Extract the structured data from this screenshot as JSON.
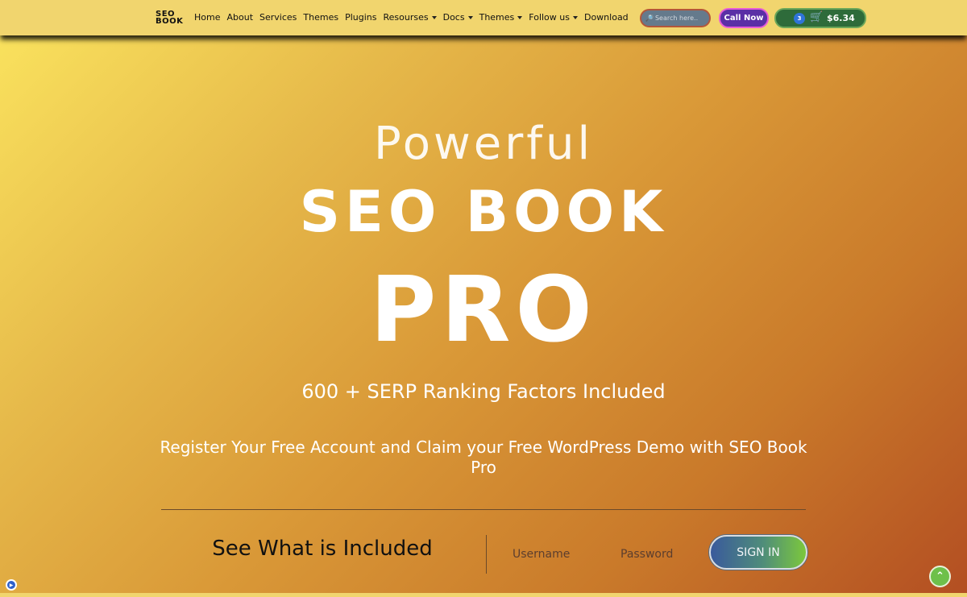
{
  "nav": {
    "logo_line1": "SEO",
    "logo_line2": "BOOK",
    "links": [
      {
        "label": "Home",
        "dropdown": false
      },
      {
        "label": "About",
        "dropdown": false
      },
      {
        "label": "Services",
        "dropdown": false
      },
      {
        "label": "Themes",
        "dropdown": false
      },
      {
        "label": "Plugins",
        "dropdown": false
      },
      {
        "label": "Resourses",
        "dropdown": true
      },
      {
        "label": "Docs",
        "dropdown": true
      },
      {
        "label": "Themes",
        "dropdown": true
      },
      {
        "label": "Follow us",
        "dropdown": true
      },
      {
        "label": "Download",
        "dropdown": false
      }
    ],
    "search_placeholder": "Search here..",
    "search_icon": "magnifier-icon",
    "call_label": "Call Now",
    "cart_count": "3",
    "cart_total": "$6.34",
    "cart_icon": "shopping-cart-icon"
  },
  "hero": {
    "small": "Powerful",
    "title": "SEO BOOK",
    "pro": "PRO",
    "tagline": "600 + SERP Ranking Factors Included",
    "register": "Register Your Free Account and Claim your Free WordPress Demo with SEO Book Pro"
  },
  "login": {
    "section_title": "See What is Included",
    "username_placeholder": "Username",
    "password_placeholder": "Password",
    "signin_label": "SIGN IN"
  },
  "colors": {
    "nav_bg": "#f1d56e",
    "call_bg": "#5a2fa6",
    "cart_bg": "#2e6b3a",
    "gradient_start": "#fbe55f",
    "gradient_end": "#b34e22"
  }
}
